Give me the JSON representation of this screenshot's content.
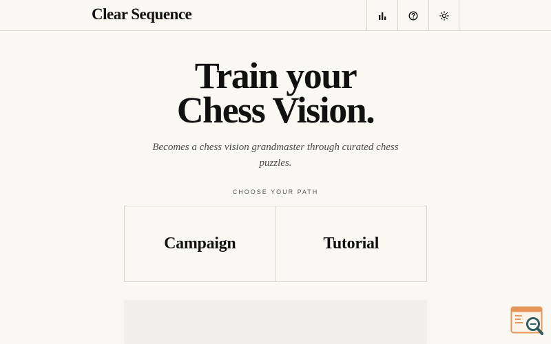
{
  "header": {
    "brand": "Clear Sequence",
    "actions": [
      {
        "icon": "bar-chart-icon"
      },
      {
        "icon": "help-circle-icon"
      },
      {
        "icon": "sun-icon"
      }
    ]
  },
  "hero": {
    "title_line_1": "Train your",
    "title_line_2": "Chess Vision.",
    "subtitle": "Becomes a chess vision grandmaster through curated chess puzzles."
  },
  "paths": {
    "label": "CHOOSE YOUR PATH",
    "options": [
      {
        "label": "Campaign"
      },
      {
        "label": "Tutorial"
      }
    ]
  },
  "colors": {
    "background": "#faf8f3",
    "ink": "#111111",
    "border": "#d9d6cf",
    "widget_accent": "#e8955a",
    "widget_magnifier": "#2f5d62"
  }
}
